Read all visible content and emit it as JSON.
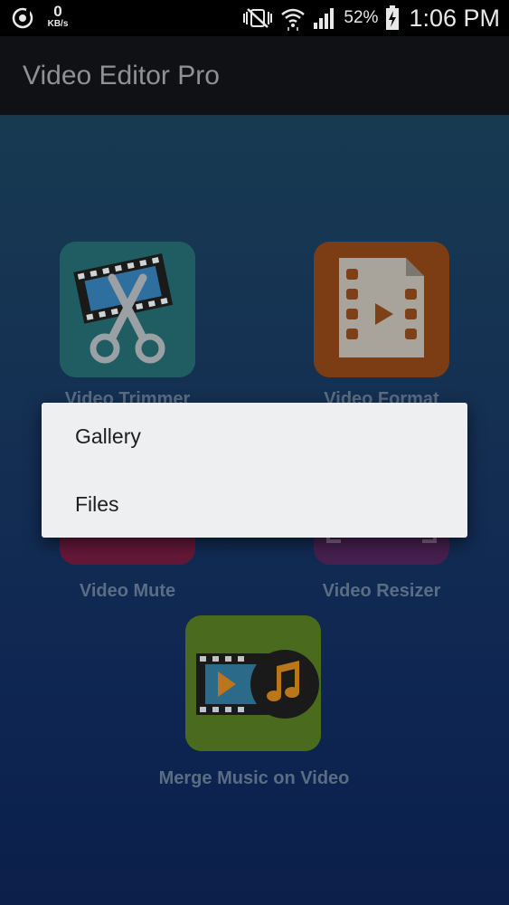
{
  "status_bar": {
    "net_speed_value": "0",
    "net_speed_unit": "KB/s",
    "battery_percent": "52%",
    "time": "1:06 PM"
  },
  "app_bar": {
    "title": "Video Editor Pro"
  },
  "tiles": [
    {
      "label": "Video Trimmer",
      "color": "#1f5e63"
    },
    {
      "label": "Video Format",
      "color": "#7c3d14"
    },
    {
      "label": "Video Mute",
      "color": "#6a1a3a"
    },
    {
      "label": "Video Resizer",
      "color": "#4b2257"
    },
    {
      "label": "Merge Music on Video",
      "color": "#4a6a1e"
    }
  ],
  "dialog": {
    "items": [
      {
        "label": "Gallery"
      },
      {
        "label": "Files"
      }
    ]
  },
  "colors": {
    "status_bar": "#000000",
    "app_bar": "#101114",
    "dialog_bg": "#eeeff1"
  }
}
